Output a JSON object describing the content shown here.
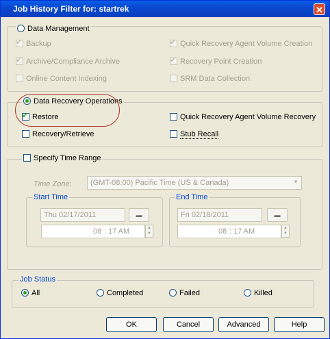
{
  "window": {
    "title": "Job History Filter for: startrek",
    "close_glyph": "✕"
  },
  "data_management": {
    "label": "Data Management",
    "items": [
      {
        "label": "Backup",
        "checked": true
      },
      {
        "label": "Archive/Compliance Archive",
        "checked": true
      },
      {
        "label": "Online Content Indexing",
        "checked": false
      },
      {
        "label": "Quick Recovery Agent Volume Creation",
        "checked": true
      },
      {
        "label": "Recovery Point Creation",
        "checked": true
      },
      {
        "label": "SRM Data Collection",
        "checked": false
      }
    ]
  },
  "data_recovery": {
    "label": "Data Recovery Operations",
    "items": [
      {
        "label": "Restore",
        "checked": true
      },
      {
        "label": "Recovery/Retrieve",
        "checked": false
      },
      {
        "label": "Quick Recovery Agent Volume Recovery",
        "checked": false
      },
      {
        "label": "Stub Recall",
        "checked": false
      }
    ]
  },
  "time_range": {
    "label": "Specify Time Range",
    "time_zone_label": "Time Zone:",
    "time_zone_value": "(GMT-08:00) Pacific Time (US & Canada)",
    "start": {
      "label": "Start Time",
      "date": "Thu 02/17/2011",
      "hour": "08",
      "minute": "17 AM"
    },
    "end": {
      "label": "End Time",
      "date": "Fri 02/18/2011",
      "hour": "08",
      "minute": "17 AM"
    }
  },
  "job_status": {
    "label": "Job Status",
    "options": [
      "All",
      "Completed",
      "Failed",
      "Killed"
    ],
    "selected": "All"
  },
  "buttons": {
    "ok": "OK",
    "cancel": "Cancel",
    "advanced": "Advanced",
    "help": "Help"
  },
  "colors": {
    "title_bar": "#0a5ee8",
    "accent_check": "#21a121",
    "highlight_ring": "#b2332c"
  }
}
